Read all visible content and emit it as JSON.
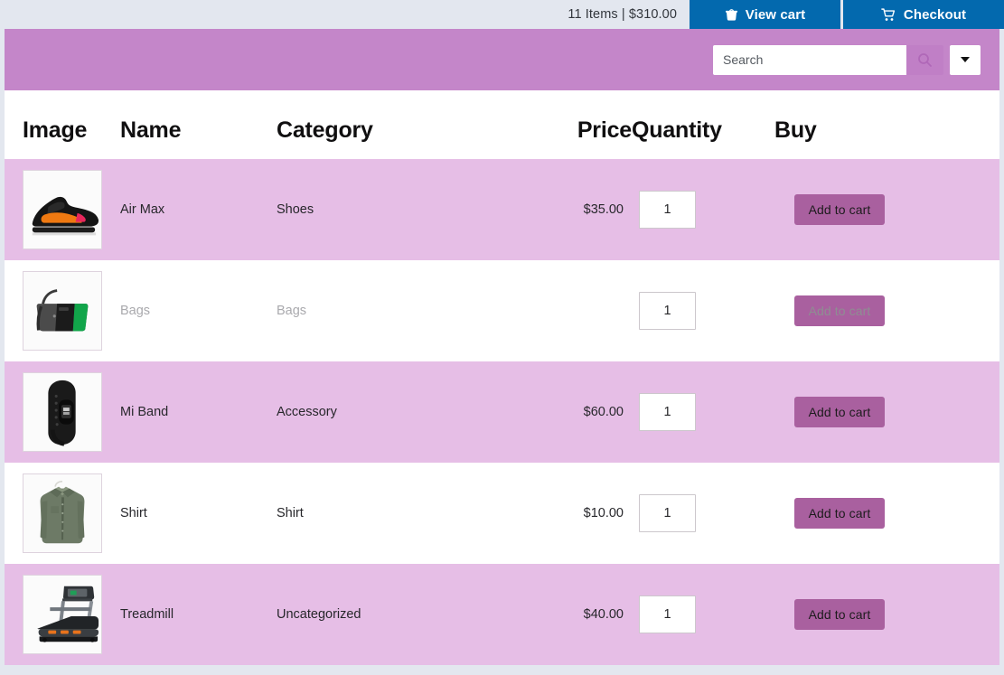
{
  "topbar": {
    "cart_summary": "11 Items | $310.00",
    "view_cart_label": "View cart",
    "checkout_label": "Checkout",
    "view_cart_icon": "basket-icon",
    "checkout_icon": "shopping-cart-icon",
    "button_color": "#0369ae",
    "background_color": "#e3e7ef"
  },
  "search": {
    "placeholder": "Search",
    "value": "",
    "search_icon": "magnifier-icon",
    "dropdown_icon": "chevron-down-icon",
    "band_color": "#c486c9"
  },
  "table": {
    "columns": [
      "Image",
      "Name",
      "Category",
      "Price",
      "Quantity",
      "Buy"
    ],
    "add_to_cart_label": "Add to cart",
    "row_highlight_color": "#e6bee6",
    "button_color": "#a9609f",
    "rows": [
      {
        "image": "sneaker",
        "name": "Air Max",
        "category": "Shoes",
        "price": "$35.00",
        "quantity": "1",
        "buy": "Add to cart",
        "disabled": false
      },
      {
        "image": "handbag",
        "name": "Bags",
        "category": "Bags",
        "price": "",
        "quantity": "1",
        "buy": "Add to cart",
        "disabled": true
      },
      {
        "image": "fitness-band",
        "name": "Mi Band",
        "category": "Accessory",
        "price": "$60.00",
        "quantity": "1",
        "buy": "Add to cart",
        "disabled": false
      },
      {
        "image": "shirt",
        "name": "Shirt",
        "category": "Shirt",
        "price": "$10.00",
        "quantity": "1",
        "buy": "Add to cart",
        "disabled": false
      },
      {
        "image": "treadmill",
        "name": "Treadmill",
        "category": "Uncategorized",
        "price": "$40.00",
        "quantity": "1",
        "buy": "Add to cart",
        "disabled": false
      }
    ]
  }
}
